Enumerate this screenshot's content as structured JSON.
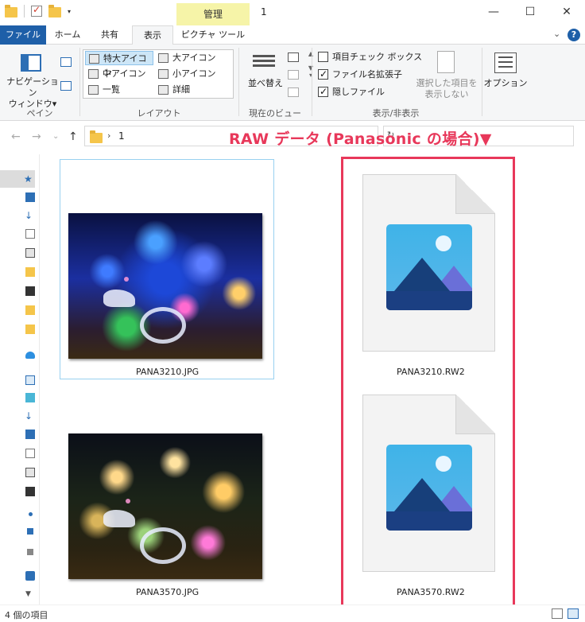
{
  "titlebar": {
    "manage_tab": "管理",
    "title": "1",
    "minimize": "—",
    "maximize": "☐",
    "close": "✕"
  },
  "tabs": [
    "ファイル",
    "ホーム",
    "共有",
    "表示",
    "ピクチャ ツール"
  ],
  "ribbon": {
    "pane": {
      "navigation_pane": "ナビゲーション\nウィンドウ▾",
      "label": "ペイン"
    },
    "layout": {
      "items": [
        "特大アイコン",
        "大アイコン",
        "中アイコン",
        "小アイコン",
        "一覧",
        "詳細"
      ],
      "selected": "特大アイコン",
      "label": "レイアウト"
    },
    "current_view": {
      "sort": "並べ替え",
      "label": "現在のビュー"
    },
    "show_hide": {
      "item_checkbox": "項目チェック ボックス",
      "item_checkbox_checked": false,
      "file_ext": "ファイル名拡張子",
      "file_ext_checked": true,
      "hidden_files": "隠しファイル",
      "hidden_files_checked": true,
      "hide_selected": "選択した項目を\n表示しない",
      "label": "表示/非表示"
    },
    "options": "オプション"
  },
  "address": {
    "path": "1"
  },
  "annotation": "RAW データ (Panasonic の場合)▼",
  "files": [
    {
      "name": "PANA3210.JPG",
      "type": "photo"
    },
    {
      "name": "PANA3210.RW2",
      "type": "raw"
    },
    {
      "name": "PANA3570.JPG",
      "type": "photo"
    },
    {
      "name": "PANA3570.RW2",
      "type": "raw"
    }
  ],
  "status": {
    "count": "4 個の項目"
  },
  "colors": {
    "file_tab": "#1e5fa8",
    "manage_tab": "#f6f4a8",
    "annotation": "#e8385a",
    "selection": "#cde6f7"
  }
}
